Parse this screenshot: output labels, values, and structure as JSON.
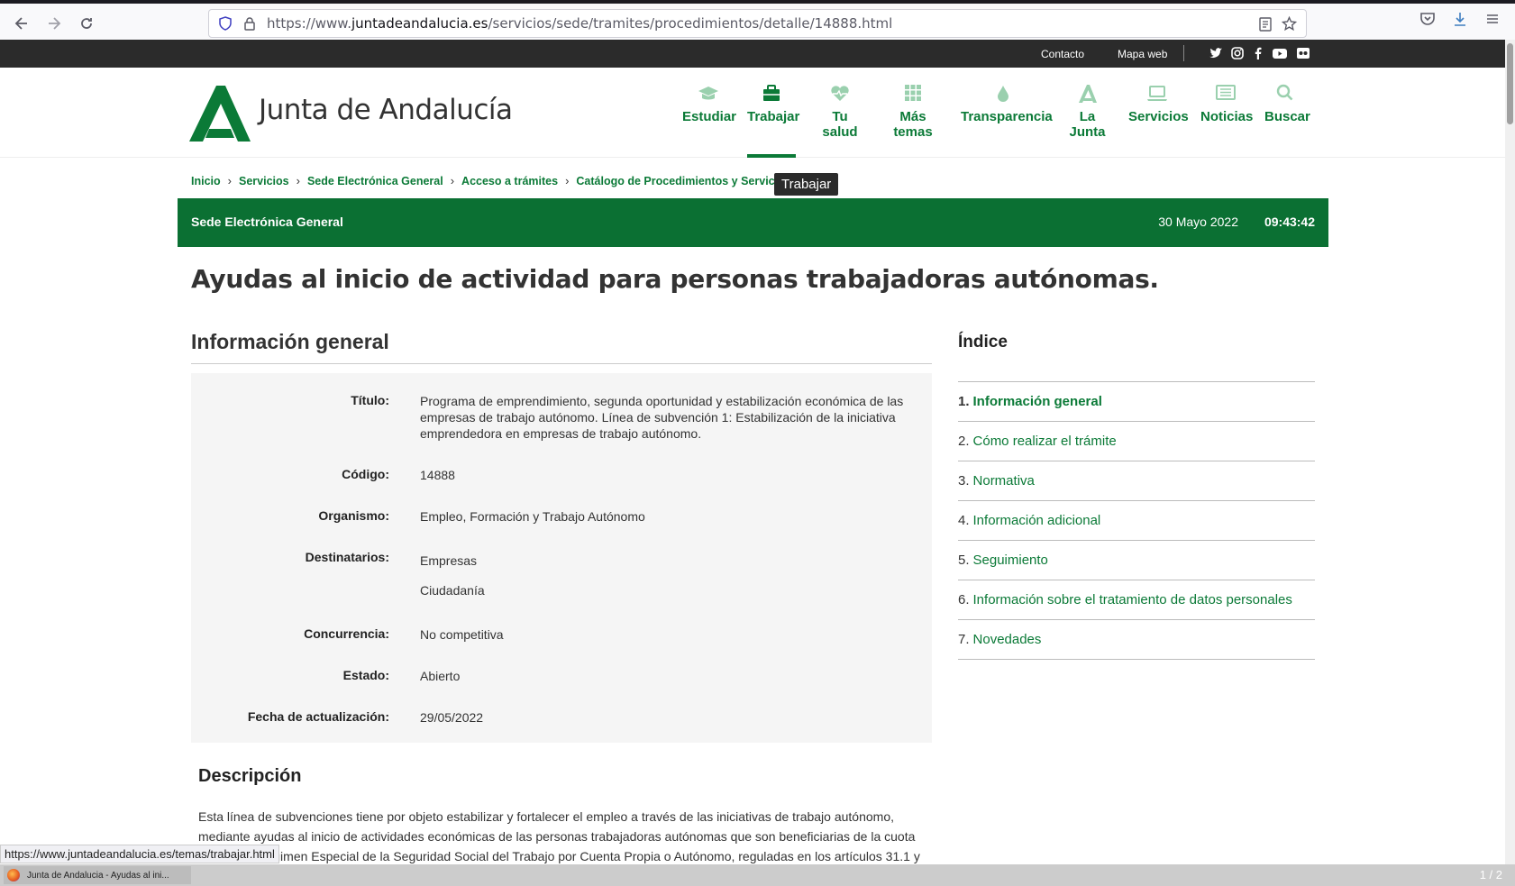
{
  "browser": {
    "url_prefix": "https://www.",
    "url_domain": "juntadeandalucia.es",
    "url_path": "/servicios/sede/tramites/procedimientos/detalle/14888.html"
  },
  "topbar": {
    "contacto": "Contacto",
    "mapa_web": "Mapa web"
  },
  "header": {
    "site_name": "Junta de Andalucía",
    "menu": [
      {
        "label": "Estudiar",
        "icon": "graduation-cap-icon"
      },
      {
        "label": "Trabajar",
        "icon": "briefcase-icon"
      },
      {
        "label": "Tu salud",
        "icon": "heart-pulse-icon"
      },
      {
        "label": "Más temas",
        "icon": "grid-icon"
      },
      {
        "label": "Transparencia",
        "icon": "drop-icon"
      },
      {
        "label": "La Junta",
        "icon": "junta-logo-icon"
      },
      {
        "label": "Servicios",
        "icon": "laptop-icon"
      },
      {
        "label": "Noticias",
        "icon": "newspaper-icon"
      },
      {
        "label": "Buscar",
        "icon": "search-icon"
      }
    ]
  },
  "breadcrumb": [
    "Inicio",
    "Servicios",
    "Sede Electrónica General",
    "Acceso a trámites",
    "Catálogo de Procedimientos y Servicios"
  ],
  "tooltip": "Trabajar",
  "greenbar": {
    "title": "Sede Electrónica General",
    "date": "30 Mayo 2022",
    "time": "09:43:42"
  },
  "page_title": "Ayudas al inicio de actividad para personas trabajadoras autónomas.",
  "info": {
    "heading": "Información general",
    "titulo_label": "Título:",
    "titulo_value": "Programa de emprendimiento, segunda oportunidad y estabilización económica de las empresas de trabajo autónomo. Línea de subvención 1: Estabilización de la iniciativa emprendedora en empresas de trabajo autónomo.",
    "codigo_label": "Código:",
    "codigo_value": "14888",
    "organismo_label": "Organismo:",
    "organismo_value": "Empleo, Formación y Trabajo Autónomo",
    "destinatarios_label": "Destinatarios:",
    "destinatarios_1": "Empresas",
    "destinatarios_2": "Ciudadanía",
    "concurrencia_label": "Concurrencia:",
    "concurrencia_value": "No competitiva",
    "estado_label": "Estado:",
    "estado_value": "Abierto",
    "fecha_label": "Fecha de actualización:",
    "fecha_value": "29/05/2022"
  },
  "indice": {
    "heading": "Índice",
    "items": [
      {
        "num": "1.",
        "label": "Información general"
      },
      {
        "num": "2.",
        "label": "Cómo realizar el trámite"
      },
      {
        "num": "3.",
        "label": "Normativa"
      },
      {
        "num": "4.",
        "label": "Información adicional"
      },
      {
        "num": "5.",
        "label": "Seguimiento"
      },
      {
        "num": "6.",
        "label": "Información sobre el tratamiento de datos personales"
      },
      {
        "num": "7.",
        "label": "Novedades"
      }
    ]
  },
  "descripcion": {
    "heading": "Descripción",
    "line1": "Esta línea de subvenciones tiene por objeto estabilizar y fortalecer el empleo a través de las iniciativas de trabajo autónomo,",
    "line2": "mediante ayudas al inicio de actividades económicas de las personas trabajadoras autónomas que son beneficiarias de la cuota",
    "line3": "cero en el Régimen Especial de la Seguridad Social del Trabajo por Cuenta Propia o Autónomo, reguladas en los artículos 31.1 y"
  },
  "status_url": "https://www.juntadeandalucia.es/temas/trabajar.html",
  "taskbar": {
    "task_label": "Junta de Andalucia - Ayudas al ini...",
    "pager": "1 / 2"
  },
  "colors": {
    "brand_green": "#0b7a37",
    "bar_green": "#0b7033",
    "topbar": "#2b2b2b"
  }
}
